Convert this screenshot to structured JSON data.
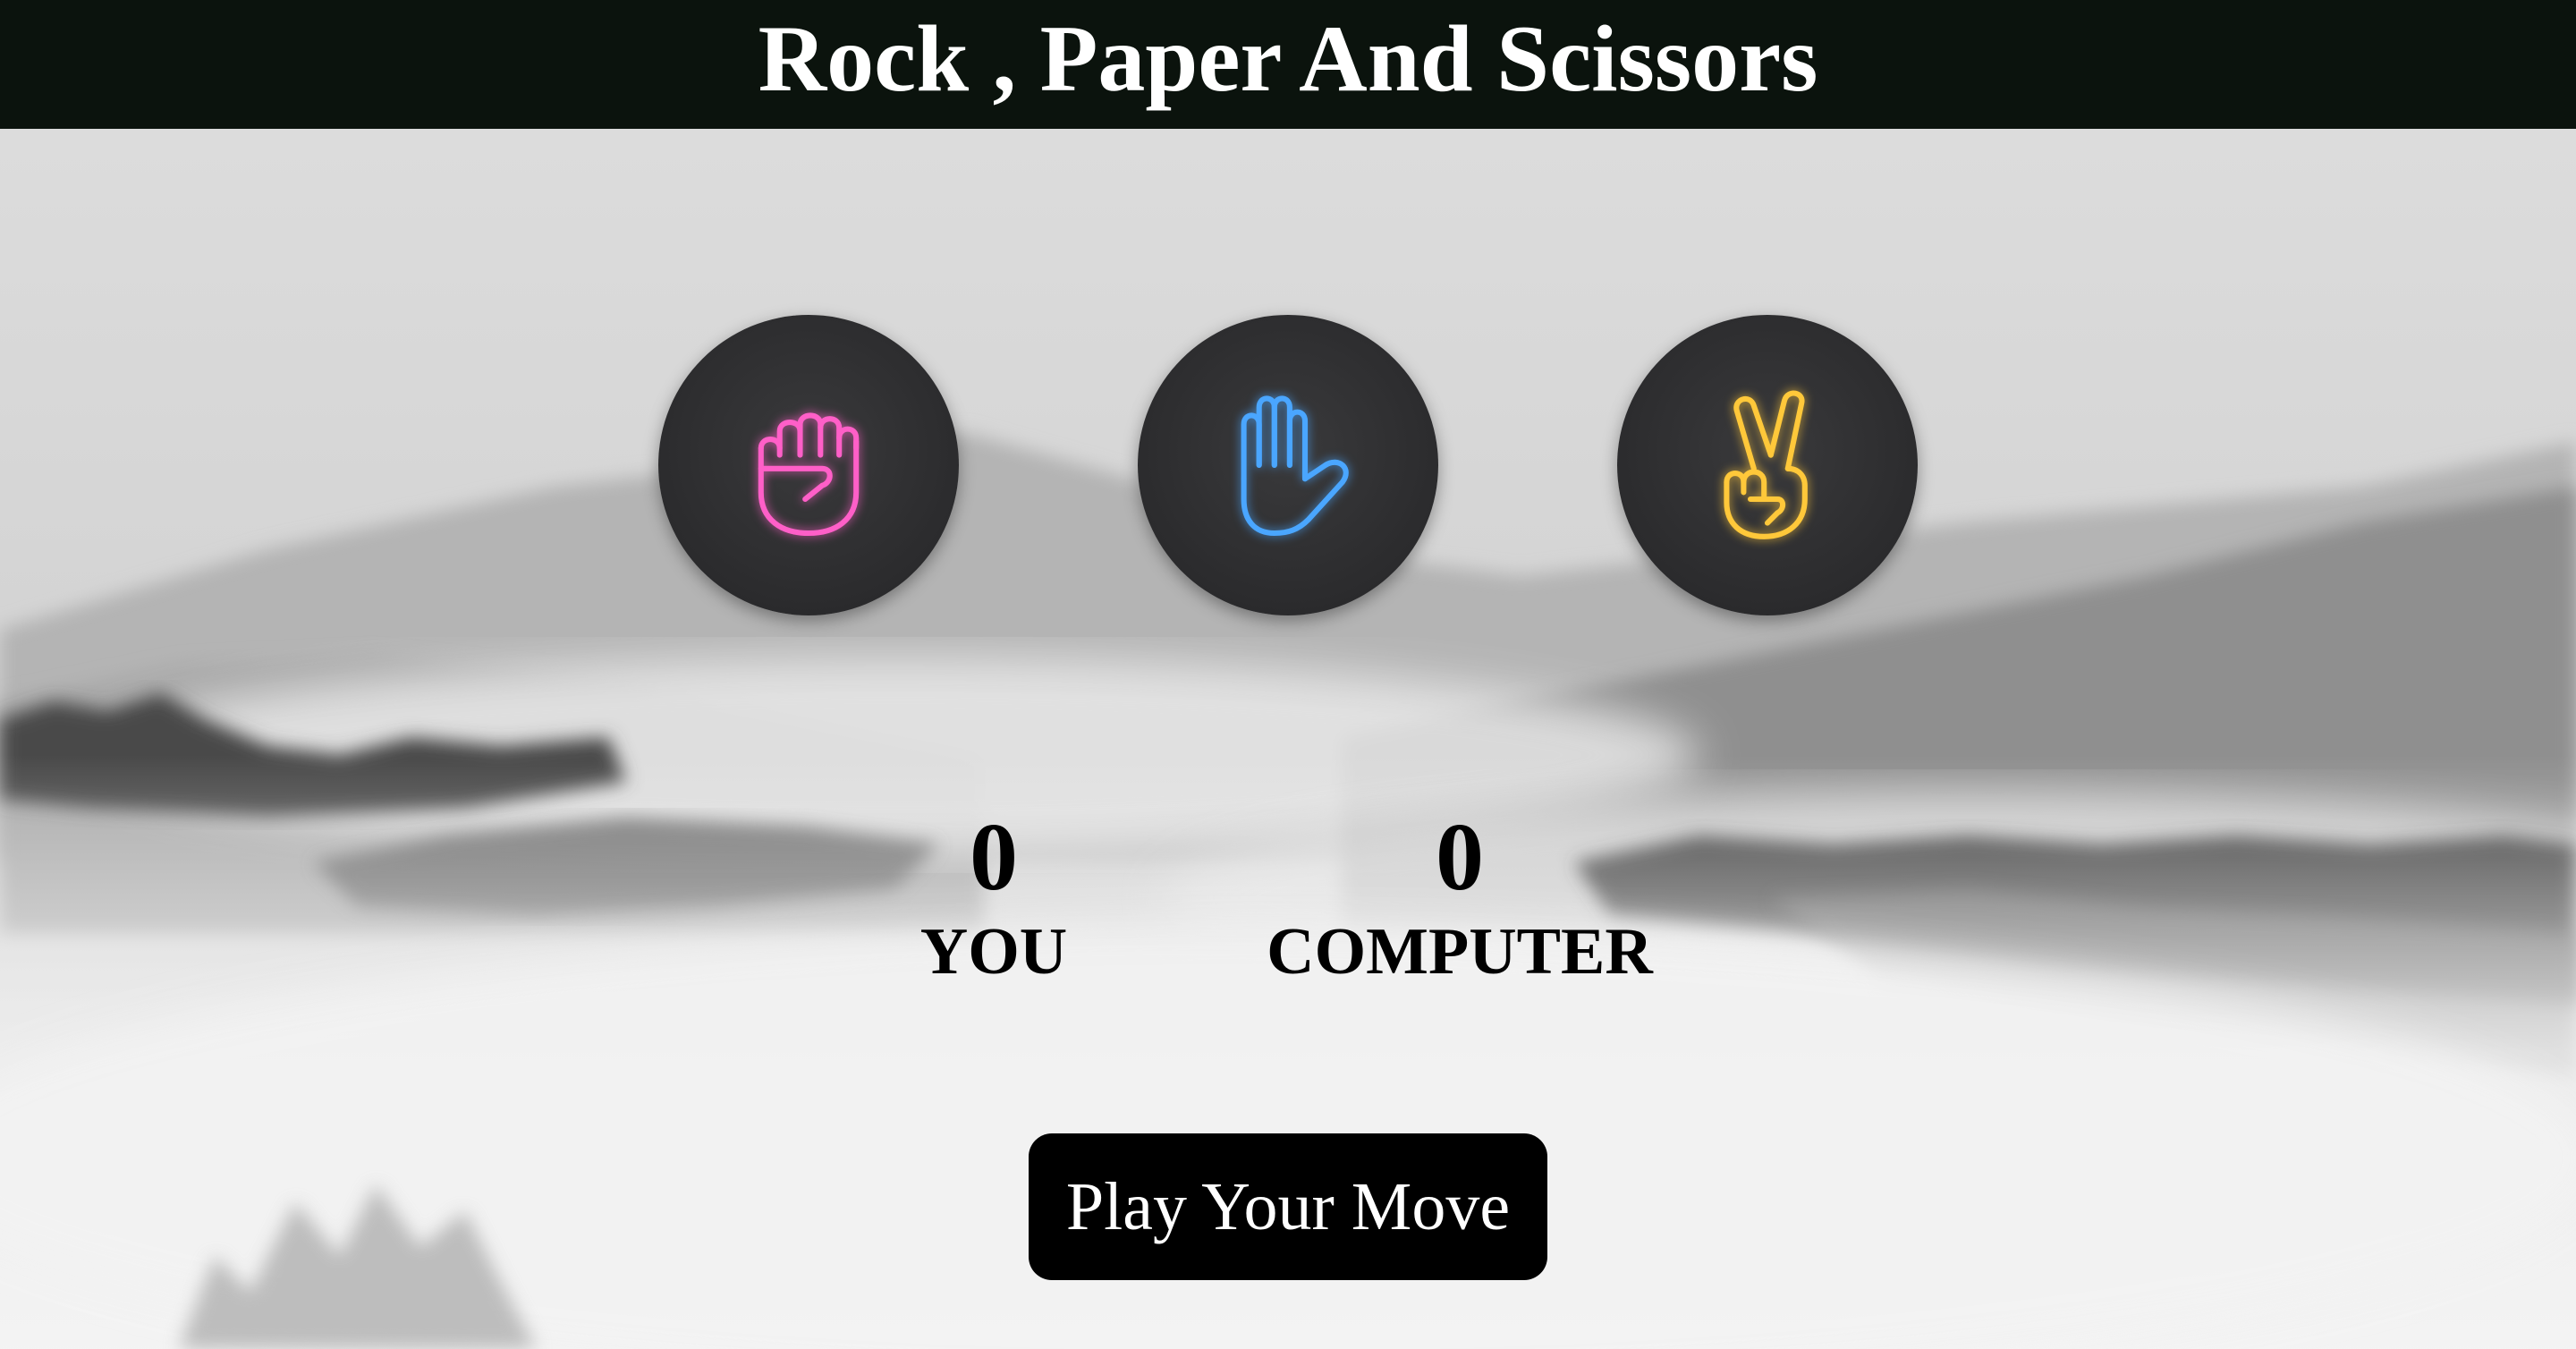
{
  "header": {
    "title": "Rock , Paper And Scissors"
  },
  "choices": [
    {
      "name": "rock",
      "icon": "fist-icon",
      "color": "#ff5fc8"
    },
    {
      "name": "paper",
      "icon": "open-hand-icon",
      "color": "#4aa6ff"
    },
    {
      "name": "scissors",
      "icon": "peace-hand-icon",
      "color": "#ffc83a"
    }
  ],
  "scoreboard": {
    "user": {
      "score": "0",
      "label": "YOU"
    },
    "computer": {
      "score": "0",
      "label": "COMPUTER"
    }
  },
  "play_button": {
    "label": "Play Your Move"
  },
  "colors": {
    "header_bg": "#0b130d",
    "choice_bg": "#2b2b2d",
    "button_bg": "#000000"
  }
}
